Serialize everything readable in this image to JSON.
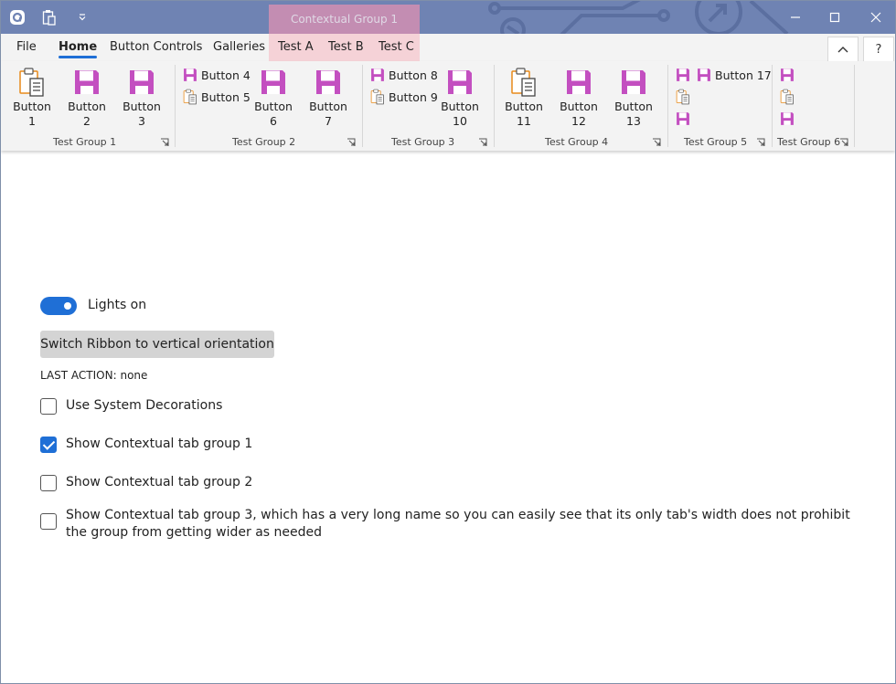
{
  "titlebar": {
    "contextual_group": "Contextual Group 1"
  },
  "tabs": [
    {
      "label": "File"
    },
    {
      "label": "Home"
    },
    {
      "label": "Button Controls"
    },
    {
      "label": "Galleries"
    },
    {
      "label": "Test A"
    },
    {
      "label": "Test B"
    },
    {
      "label": "Test C"
    }
  ],
  "ribbon_help": "?",
  "groups": [
    {
      "label": "Test Group 1"
    },
    {
      "label": "Test Group 2"
    },
    {
      "label": "Test Group 3"
    },
    {
      "label": "Test Group 4"
    },
    {
      "label": "Test Group 5"
    },
    {
      "label": "Test Group 6"
    }
  ],
  "buttons": {
    "b1": [
      "Button",
      "1"
    ],
    "b2": [
      "Button",
      "2"
    ],
    "b3": [
      "Button",
      "3"
    ],
    "b4": "Button 4",
    "b5": "Button 5",
    "b6": [
      "Button",
      "6"
    ],
    "b7": [
      "Button",
      "7"
    ],
    "b8": "Button 8",
    "b9": "Button 9",
    "b10": [
      "Button",
      "10"
    ],
    "b11": [
      "Button",
      "11"
    ],
    "b12": [
      "Button",
      "12"
    ],
    "b13": [
      "Button",
      "13"
    ],
    "b17": "Button 17"
  },
  "content": {
    "toggle_label": "Lights on",
    "toggle_on": true,
    "switch_button": "Switch Ribbon to vertical orientation",
    "last_action": "LAST ACTION: none",
    "checkboxes": [
      {
        "label": "Use System Decorations",
        "checked": false
      },
      {
        "label": "Show Contextual tab group 1",
        "checked": true
      },
      {
        "label": "Show Contextual tab group 2",
        "checked": false
      },
      {
        "label": "Show Contextual tab group 3, which has a very long name so you can easily see that its only tab's width does not prohibit the group from getting wider as needed",
        "checked": false
      }
    ]
  },
  "colors": {
    "titlebar": "#6f83b3",
    "accent": "#1f6fd6",
    "contextual_tab_bg": "#f5d2d7",
    "save_icon": "#c34fc0"
  }
}
